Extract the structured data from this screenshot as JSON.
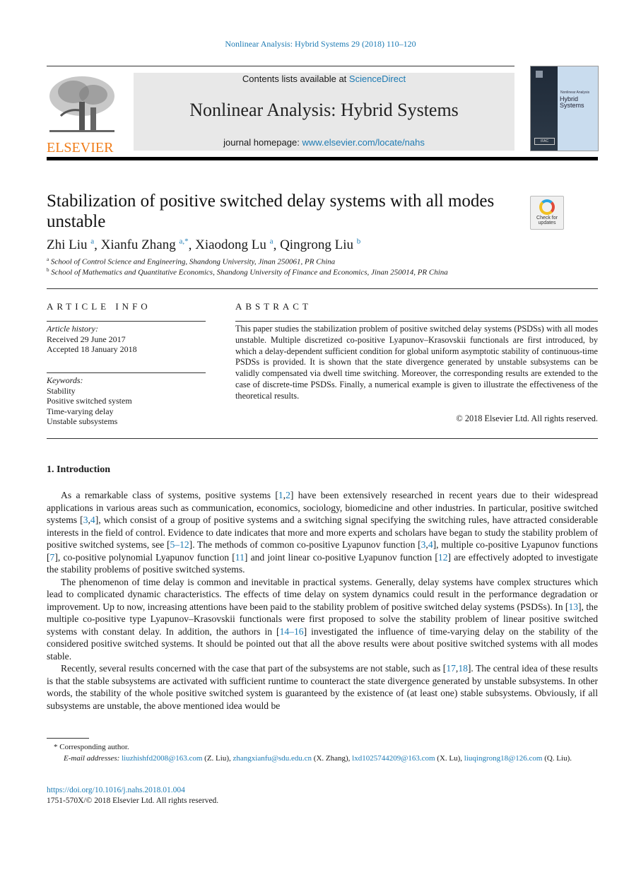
{
  "running_head": "Nonlinear Analysis: Hybrid Systems 29 (2018) 110–120",
  "masthead": {
    "publisher": "ELSEVIER",
    "contents_prefix": "Contents lists available at ",
    "contents_link": "ScienceDirect",
    "journal_title": "Nonlinear Analysis: Hybrid Systems",
    "homepage_prefix": "journal homepage: ",
    "homepage_link": "www.elsevier.com/locate/nahs",
    "cover": {
      "subtitle": "Nonlinear Analysis",
      "title_line1": "Hybrid",
      "title_line2": "Systems",
      "badge": "IFAC"
    }
  },
  "check_updates": {
    "line1": "Check for",
    "line2": "updates"
  },
  "article": {
    "title": "Stabilization of positive switched delay systems with all modes unstable",
    "authors": [
      {
        "name": "Zhi Liu",
        "sup": "a"
      },
      {
        "name": "Xianfu Zhang",
        "sup": "a,*"
      },
      {
        "name": "Xiaodong Lu",
        "sup": "a"
      },
      {
        "name": "Qingrong Liu",
        "sup": "b"
      }
    ],
    "affiliations": [
      {
        "sup": "a",
        "text": "School of Control Science and Engineering, Shandong University, Jinan 250061, PR China"
      },
      {
        "sup": "b",
        "text": "School of Mathematics and Quantitative Economics, Shandong University of Finance and Economics, Jinan 250014, PR China"
      }
    ]
  },
  "article_info": {
    "heading": "ARTICLE INFO",
    "history_label": "Article history:",
    "received": "Received 29 June 2017",
    "accepted": "Accepted 18 January 2018",
    "keywords_label": "Keywords:",
    "keywords": [
      "Stability",
      "Positive switched system",
      "Time-varying delay",
      "Unstable subsystems"
    ]
  },
  "abstract": {
    "heading": "ABSTRACT",
    "text": "This paper studies the stabilization problem of positive switched delay systems (PSDSs) with all modes unstable. Multiple discretized co-positive Lyapunov–Krasovskii functionals are first introduced, by which a delay-dependent sufficient condition for global uniform asymptotic stability of continuous-time PSDSs is provided. It is shown that the state divergence generated by unstable subsystems can be validly compensated via dwell time switching. Moreover, the corresponding results are extended to the case of discrete-time PSDSs. Finally, a numerical example is given to illustrate the effectiveness of the theoretical results.",
    "copyright": "© 2018 Elsevier Ltd. All rights reserved."
  },
  "introduction": {
    "heading": "1.  Introduction",
    "p1": [
      "As a remarkable class of systems, positive systems [",
      {
        "ref": "1"
      },
      ",",
      {
        "ref": "2"
      },
      "] have been extensively researched in recent years due to their widespread applications in various areas such as communication, economics, sociology, biomedicine and other industries. In particular, positive switched systems [",
      {
        "ref": "3"
      },
      ",",
      {
        "ref": "4"
      },
      "], which consist of a group of positive systems and a switching signal specifying the switching rules, have attracted considerable interests in the field of control. Evidence to date indicates that more and more experts and scholars have began to study the stability problem of positive switched systems, see [",
      {
        "ref": "5–12"
      },
      "]. The methods of common co-positive Lyapunov function [",
      {
        "ref": "3"
      },
      ",",
      {
        "ref": "4"
      },
      "], multiple co-positive Lyapunov functions [",
      {
        "ref": "7"
      },
      "], co-positive polynomial Lyapunov function [",
      {
        "ref": "11"
      },
      "] and joint linear co-positive Lyapunov function [",
      {
        "ref": "12"
      },
      "] are effectively adopted to investigate the stability problems of positive switched systems."
    ],
    "p2": [
      "The phenomenon of time delay is common and inevitable in practical systems. Generally, delay systems have complex structures which lead to complicated dynamic characteristics. The effects of time delay on system dynamics could result in the performance degradation or improvement. Up to now, increasing attentions have been paid to the stability problem of positive switched delay systems (PSDSs). In [",
      {
        "ref": "13"
      },
      "], the multiple co-positive type Lyapunov–Krasovskii functionals were first proposed to solve the stability problem of linear positive switched systems with constant delay. In addition, the authors in [",
      {
        "ref": "14–16"
      },
      "] investigated the influence of time-varying delay on the stability of the considered positive switched systems. It should be pointed out that all the above results were about positive switched systems with all modes stable."
    ],
    "p3": [
      "Recently, several results concerned with the case that part of the subsystems are not stable, such as [",
      {
        "ref": "17"
      },
      ",",
      {
        "ref": "18"
      },
      "]. The central idea of these results is that the stable subsystems are activated with sufficient runtime to counteract the state divergence generated by unstable subsystems. In other words, the stability of the whole positive switched system is guaranteed by the existence of (at least one) stable subsystems. Obviously, if all subsystems are unstable, the above mentioned idea would be"
    ]
  },
  "footnotes": {
    "corresponding": "Corresponding author.",
    "email_label": "E-mail addresses:",
    "emails": [
      {
        "addr": "liuzhishfd2008@163.com",
        "who": " (Z. Liu), "
      },
      {
        "addr": "zhangxianfu@sdu.edu.cn",
        "who": " (X. Zhang), "
      },
      {
        "addr": "lxd1025744209@163.com",
        "who": " (X. Lu), "
      },
      {
        "addr": "liuqingrong18@126.com",
        "who": " (Q. Liu)."
      }
    ],
    "doi": "https://doi.org/10.1016/j.nahs.2018.01.004",
    "issn": "1751-570X/© 2018 Elsevier Ltd.  All rights reserved."
  },
  "colors": {
    "link": "#1c7ab3",
    "publisher_orange": "#f07c18",
    "banner_bg": "#e8e8e8"
  }
}
